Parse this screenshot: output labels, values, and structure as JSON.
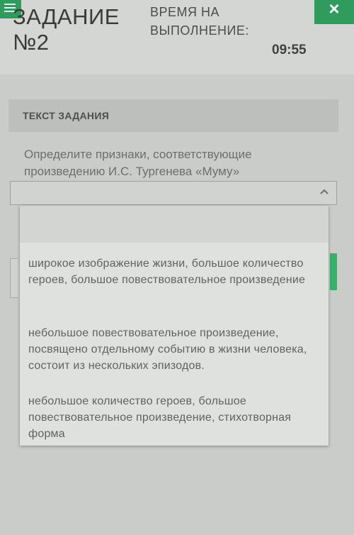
{
  "header": {
    "task_title_line1": "ЗАДАНИЕ",
    "task_title_line2": "№2",
    "time_label_line1": "ВРЕМЯ НА",
    "time_label_line2": "ВЫПОЛНЕНИЕ:",
    "time_value": "09:55",
    "close_glyph": "×"
  },
  "task": {
    "heading": "ТЕКСТ ЗАДАНИЯ",
    "question": "Определите признаки, соответствующие произведению И.С. Тургенева «Муму»"
  },
  "dropdown": {
    "selected_value": "",
    "options": [
      "широкое изображение жизни, большое количество героев, большое повествовательное произведение",
      "небольшое повествовательное произведение, посвящено отдельному событию в жизни человека, состоит из нескольких эпизодов.",
      "небольшое количество героев, большое повествовательное произведение, стихотворная форма"
    ]
  },
  "colors": {
    "accent_green": "#2f9c5d",
    "background": "#c9ccc9"
  },
  "icons": {
    "menu": "menu-icon",
    "close": "close-icon",
    "chevron": "chevron-up-icon"
  }
}
